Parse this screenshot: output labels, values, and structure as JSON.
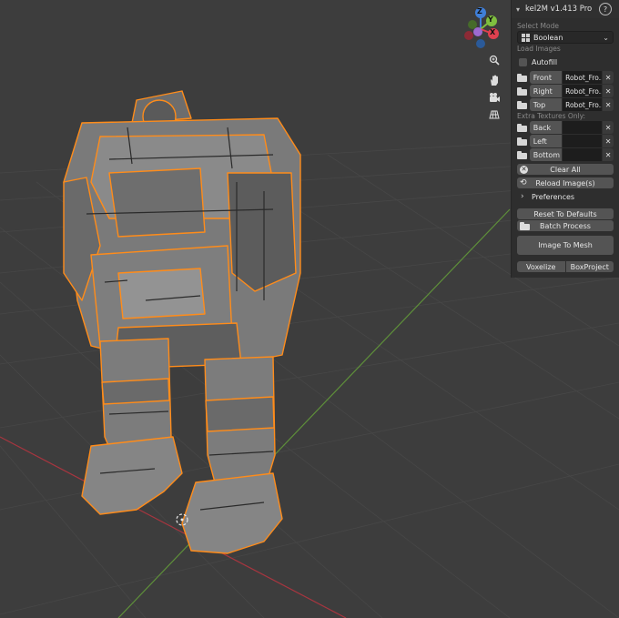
{
  "panel": {
    "title": "kel2M v1.413 Pro",
    "help": "?",
    "select_mode_label": "Select Mode",
    "mode_value": "Boolean",
    "load_images_label": "Load Images",
    "autofill_label": "Autofill",
    "images": [
      {
        "label": "Front",
        "value": "Robot_Fro..."
      },
      {
        "label": "Right",
        "value": "Robot_Fro..."
      },
      {
        "label": "Top",
        "value": "Robot_Fro..."
      }
    ],
    "extra_textures_label": "Extra Textures Only:",
    "extra_images": [
      {
        "label": "Back",
        "value": ""
      },
      {
        "label": "Left",
        "value": ""
      },
      {
        "label": "Bottom",
        "value": ""
      }
    ],
    "remove_glyph": "✕",
    "clear_all": "Clear All",
    "reload_images": "Reload Image(s)",
    "preferences": "Preferences",
    "reset_defaults": "Reset To Defaults",
    "batch_process": "Batch Process",
    "image_to_mesh": "Image To Mesh",
    "voxelize": "Voxelize",
    "boxproject": "BoxProject"
  },
  "gizmo": {
    "z": "Z",
    "y": "Y",
    "x": "X",
    "colors": {
      "x": "#e0404f",
      "y": "#7fbf3f",
      "z": "#3f7fd9"
    }
  },
  "nav_icons": [
    "zoom-icon",
    "hand-pan-icon",
    "camera-icon",
    "grid-view-icon"
  ],
  "viewport": {
    "background": "#3d3d3d",
    "x_axis_color": "#a8353f",
    "y_axis_color": "#5e8f3a",
    "selection_color": "#ff8c1a"
  }
}
